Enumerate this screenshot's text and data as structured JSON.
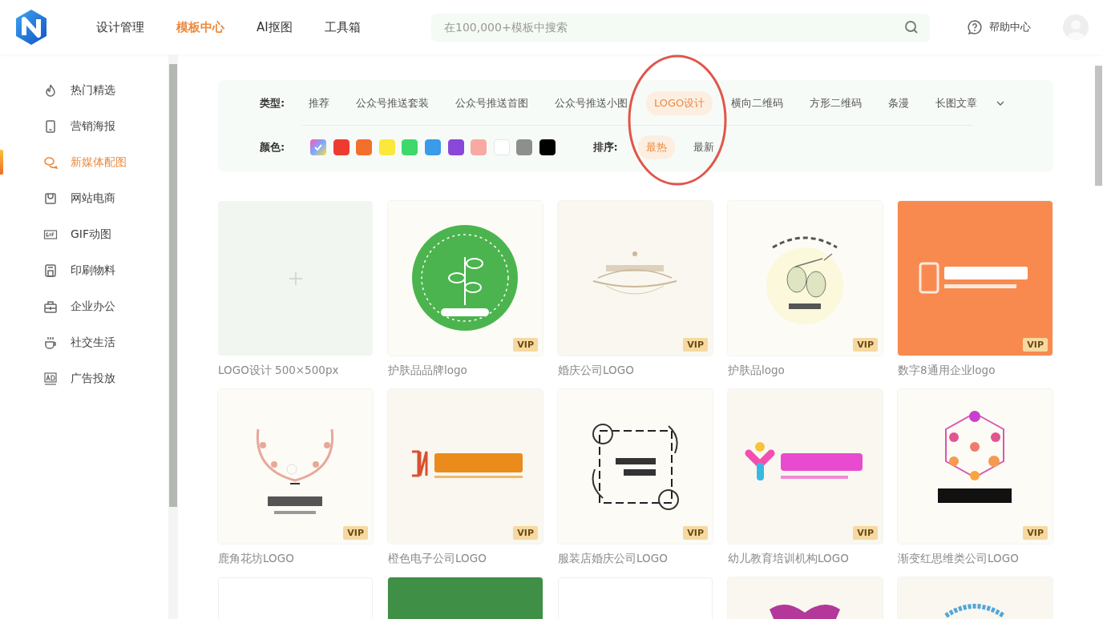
{
  "header": {
    "nav": [
      {
        "label": "设计管理",
        "selected": false
      },
      {
        "label": "模板中心",
        "selected": true
      },
      {
        "label": "AI抠图",
        "selected": false
      },
      {
        "label": "工具箱",
        "selected": false
      }
    ],
    "search": {
      "placeholder": "在100,000+模板中搜索"
    },
    "help": "帮助中心"
  },
  "sidebar": {
    "items": [
      {
        "label": "热门精选",
        "selected": false
      },
      {
        "label": "营销海报",
        "selected": false
      },
      {
        "label": "新媒体配图",
        "selected": true
      },
      {
        "label": "网站电商",
        "selected": false
      },
      {
        "label": "GIF动图",
        "selected": false
      },
      {
        "label": "印刷物料",
        "selected": false
      },
      {
        "label": "企业办公",
        "selected": false
      },
      {
        "label": "社交生活",
        "selected": false
      },
      {
        "label": "广告投放",
        "selected": false
      }
    ]
  },
  "filters": {
    "type_label": "类型:",
    "types": [
      {
        "label": "推荐",
        "selected": false
      },
      {
        "label": "公众号推送套装",
        "selected": false
      },
      {
        "label": "公众号推送首图",
        "selected": false
      },
      {
        "label": "公众号推送小图",
        "selected": false
      },
      {
        "label": "LOGO设计",
        "selected": true
      },
      {
        "label": "横向二维码",
        "selected": false
      },
      {
        "label": "方形二维码",
        "selected": false
      },
      {
        "label": "条漫",
        "selected": false
      },
      {
        "label": "长图文章",
        "selected": false
      }
    ],
    "color_label": "颜色:",
    "colors": [
      {
        "kind": "all",
        "selected": true
      },
      {
        "kind": "swatch",
        "color": "#ee3b30",
        "selected": false
      },
      {
        "kind": "swatch",
        "color": "#f36f2d",
        "selected": false
      },
      {
        "kind": "swatch",
        "color": "#fbe83a",
        "selected": false
      },
      {
        "kind": "swatch",
        "color": "#3fd86a",
        "selected": false
      },
      {
        "kind": "swatch",
        "color": "#3a9be9",
        "selected": false
      },
      {
        "kind": "swatch",
        "color": "#8a48d8",
        "selected": false
      },
      {
        "kind": "swatch",
        "color": "#f8aaa2",
        "selected": false
      },
      {
        "kind": "swatch",
        "color": "#ffffff",
        "selected": false
      },
      {
        "kind": "swatch",
        "color": "#8c8f8c",
        "selected": false
      },
      {
        "kind": "swatch",
        "color": "#000000",
        "selected": false
      }
    ],
    "sort_label": "排序:",
    "sorts": [
      {
        "label": "最热",
        "selected": true
      },
      {
        "label": "最新",
        "selected": false
      }
    ]
  },
  "templates": [
    {
      "kind": "blank",
      "title": "LOGO设计 500×500px"
    },
    {
      "kind": "picture",
      "title": "护肤品品牌logo",
      "badge": "VIP"
    },
    {
      "kind": "picture",
      "title": "婚庆公司LOGO",
      "badge": "VIP"
    },
    {
      "kind": "picture",
      "title": "护肤品logo",
      "badge": "VIP"
    },
    {
      "kind": "picture",
      "title": "数字8通用企业logo",
      "badge": "VIP"
    },
    {
      "kind": "picture",
      "title": "鹿角花坊LOGO",
      "badge": "VIP"
    },
    {
      "kind": "picture",
      "title": "橙色电子公司LOGO",
      "badge": "VIP"
    },
    {
      "kind": "picture",
      "title": "服装店婚庆公司LOGO",
      "badge": "VIP"
    },
    {
      "kind": "picture",
      "title": "幼儿教育培训机构LOGO",
      "badge": "VIP"
    },
    {
      "kind": "picture",
      "title": "渐变红思维类公司LOGO",
      "badge": "VIP"
    },
    {
      "kind": "card"
    },
    {
      "kind": "picture"
    },
    {
      "kind": "card"
    },
    {
      "kind": "picture"
    },
    {
      "kind": "picture"
    }
  ],
  "annotations": [
    {
      "kind": "ellipse"
    }
  ]
}
